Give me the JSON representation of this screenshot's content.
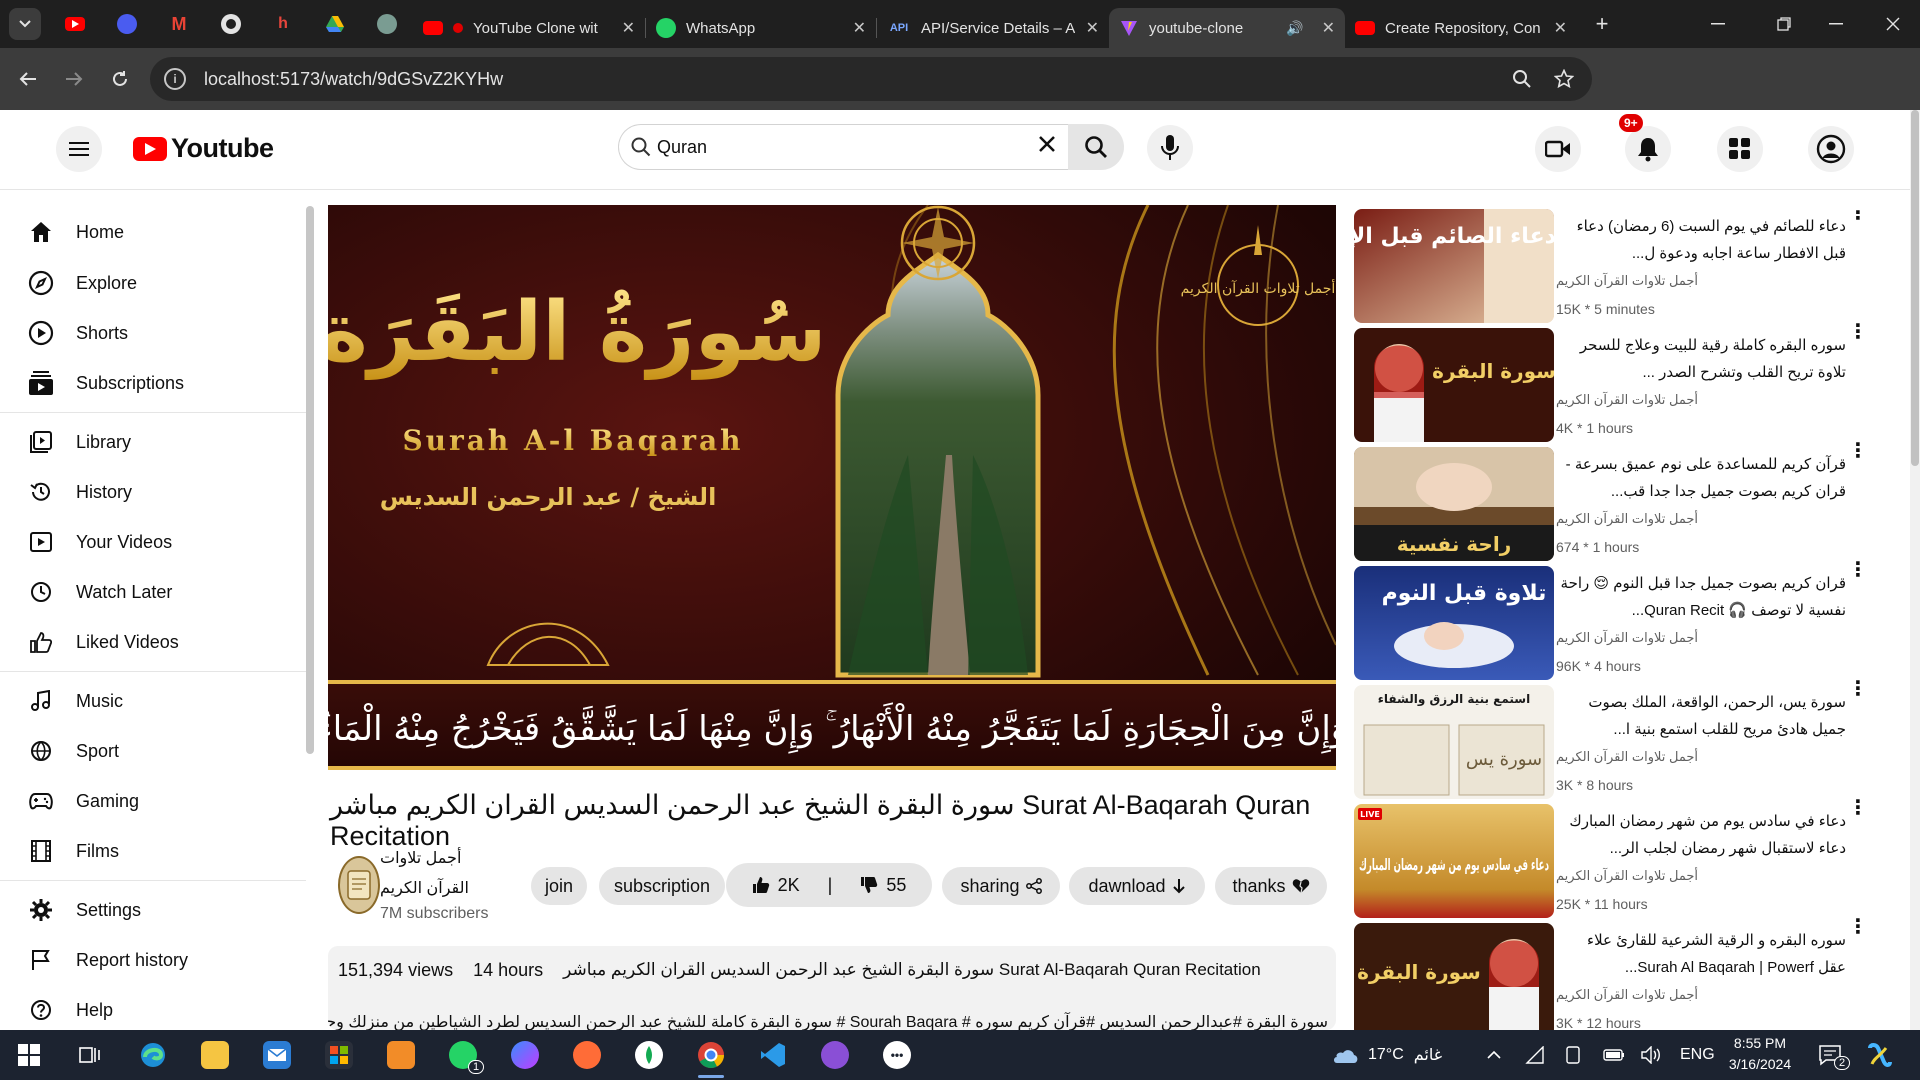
{
  "browser": {
    "tabs": [
      {
        "title": "YouTube Clone wit",
        "favicon": "youtube-icon",
        "active": false
      },
      {
        "title": "WhatsApp",
        "favicon": "whatsapp-icon",
        "active": false
      },
      {
        "title": "API/Service Details – A",
        "favicon": "api-icon",
        "active": false
      },
      {
        "title": "youtube-clone",
        "favicon": "vite-icon",
        "active": true
      },
      {
        "title": "Create Repository, Con",
        "favicon": "youtube-icon",
        "active": false
      }
    ],
    "url": "localhost:5173/watch/9dGSvZ2KYHw"
  },
  "header": {
    "logo_text": "Youtube",
    "search_value": "Quran",
    "notification_count": "9+"
  },
  "sidebar": {
    "section1": [
      {
        "label": "Home",
        "icon": "home-icon"
      },
      {
        "label": "Explore",
        "icon": "compass-icon"
      },
      {
        "label": "Shorts",
        "icon": "shorts-icon"
      },
      {
        "label": "Subscriptions",
        "icon": "subscriptions-icon"
      }
    ],
    "section2": [
      {
        "label": "Library",
        "icon": "library-icon"
      },
      {
        "label": "History",
        "icon": "history-icon"
      },
      {
        "label": "Your Videos",
        "icon": "your-videos-icon"
      },
      {
        "label": "Watch Later",
        "icon": "clock-icon"
      },
      {
        "label": "Liked Videos",
        "icon": "thumbs-up-icon"
      }
    ],
    "section3": [
      {
        "label": "Music",
        "icon": "music-icon"
      },
      {
        "label": "Sport",
        "icon": "sport-icon"
      },
      {
        "label": "Gaming",
        "icon": "gamepad-icon"
      },
      {
        "label": "Films",
        "icon": "film-icon"
      }
    ],
    "section4": [
      {
        "label": "Settings",
        "icon": "gear-icon"
      },
      {
        "label": "Report history",
        "icon": "flag-icon"
      },
      {
        "label": "Help",
        "icon": "help-icon"
      }
    ]
  },
  "player": {
    "title_ar": "سُورَةُ البَقَرَة",
    "title_en": "Surah A-l Baqarah",
    "reciter": "الشيخ / عبد الرحمن السديس",
    "verse": "وَإِنَّ مِنَ الْحِجَارَةِ لَمَا يَتَفَجَّرُ مِنْهُ الْأَنْهَارُ ۚ وَإِنَّ مِنْهَا لَمَا يَشَّقَّقُ فَيَخْرُجُ مِنْهُ الْمَاءُ",
    "badge": "أجمل تلاوات القرآن الكريم"
  },
  "video": {
    "title": "سورة البقرة الشيخ عبد الرحمن السديس القران الكريم مباشر Surat Al-Baqarah Quran Recitation",
    "channel_name": "أجمل تلاوات القرآن الكريم",
    "subscribers": "7M subscribers",
    "buttons": {
      "join": "join",
      "subscribe": "subscription",
      "likes": "2K",
      "dislikes": "55",
      "share": "sharing",
      "download": "dawnload",
      "thanks": "thanks"
    },
    "views": "151,394 views",
    "time": "14 hours",
    "desc_title": "سورة البقرة الشيخ عبد الرحمن السديس القران الكريم مباشر Surat Al-Baqarah Quran Recitation",
    "desc_tags": "سورة البقرة #عبدالرحمن السديس #قرآن كريم سوره # Sourah Baqara # سورة البقرة كاملة للشيخ عبد الرحمن السديس لطرد الشياطين من منزلك وجلب البركة بإذن الله"
  },
  "recommendations": [
    {
      "title": "دعاء للصائم في يوم السبت (6 رمضان) دعاء قبل الافطار ساعة اجابه ودعوة ل...",
      "channel": "أجمل تلاوات القرآن الكريم",
      "meta": "15K * 5 minutes",
      "thumb_text": "دعاء الصائم قبل الإفطار"
    },
    {
      "title": "سوره البقره كاملة رقية للبيت وعلاج للسحر تلاوة تريح القلب وتشرح الصدر ...",
      "channel": "أجمل تلاوات القرآن الكريم",
      "meta": "4K * 1 hours",
      "thumb_text": "سورة البقرة"
    },
    {
      "title": "قرآن كريم للمساعدة على نوم عميق بسرعة - قران كريم بصوت جميل جدا جدا قب...",
      "channel": "أجمل تلاوات القرآن الكريم",
      "meta": "674 * 1 hours",
      "thumb_text": "راحة نفسية"
    },
    {
      "title": "قران كريم بصوت جميل جدا قبل النوم 😌 راحة نفسية لا توصف 🎧 Quran Recit...",
      "channel": "أجمل تلاوات القرآن الكريم",
      "meta": "96K * 4 hours",
      "thumb_text": "تلاوة قبل النوم"
    },
    {
      "title": "سورة يس، الرحمن، الواقعة، الملك بصوت جميل هادئ مريح للقلب استمع بنية ا...",
      "channel": "أجمل تلاوات القرآن الكريم",
      "meta": "3K * 8 hours",
      "thumb_text": "سورة يس"
    },
    {
      "title": "دعاء في سادس يوم من شهر رمضان المبارك دعاء لاستقبال شهر رمضان لجلب الر...",
      "channel": "أجمل تلاوات القرآن الكريم",
      "meta": "25K * 11 hours",
      "thumb_text": "دعاء في سادس يوم من شهر رمضان المبارك"
    },
    {
      "title": "سوره البقره و الرقية الشرعية للقارئ علاء عقل Surah Al Baqarah | Powerf...",
      "channel": "أجمل تلاوات القرآن الكريم",
      "meta": "3K * 12 hours",
      "thumb_text": "سورة البقرة"
    }
  ],
  "taskbar": {
    "weather": "17°C",
    "weather_label": "غائم",
    "language": "ENG",
    "time": "8:55 PM",
    "date": "3/16/2024",
    "whatsapp_badge": "1",
    "notif_badge": "2"
  }
}
